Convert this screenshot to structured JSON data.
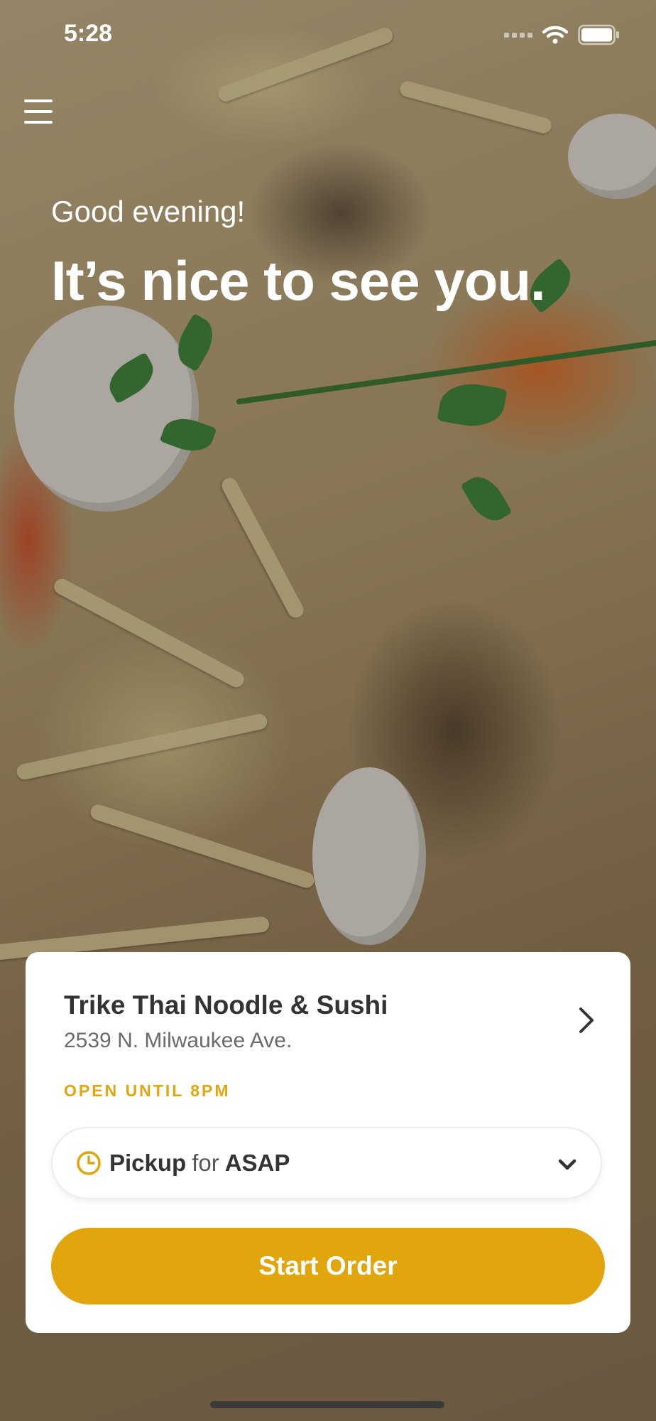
{
  "status_bar": {
    "time": "5:28"
  },
  "hero": {
    "greeting": "Good evening!",
    "headline": "It’s nice to see you."
  },
  "restaurant": {
    "name": "Trike Thai Noodle & Sushi",
    "address": "2539 N. Milwaukee Ave.",
    "hours": "OPEN UNTIL 8PM"
  },
  "order_mode": {
    "mode": "Pickup",
    "connector": "for",
    "time": "ASAP"
  },
  "actions": {
    "start_order": "Start Order"
  },
  "colors": {
    "accent": "#e1a50e",
    "card": "#ffffff",
    "text": "#333333"
  },
  "icons": [
    "menu-icon",
    "wifi-icon",
    "battery-icon",
    "chevron-right-icon",
    "clock-icon",
    "chevron-down-icon"
  ]
}
